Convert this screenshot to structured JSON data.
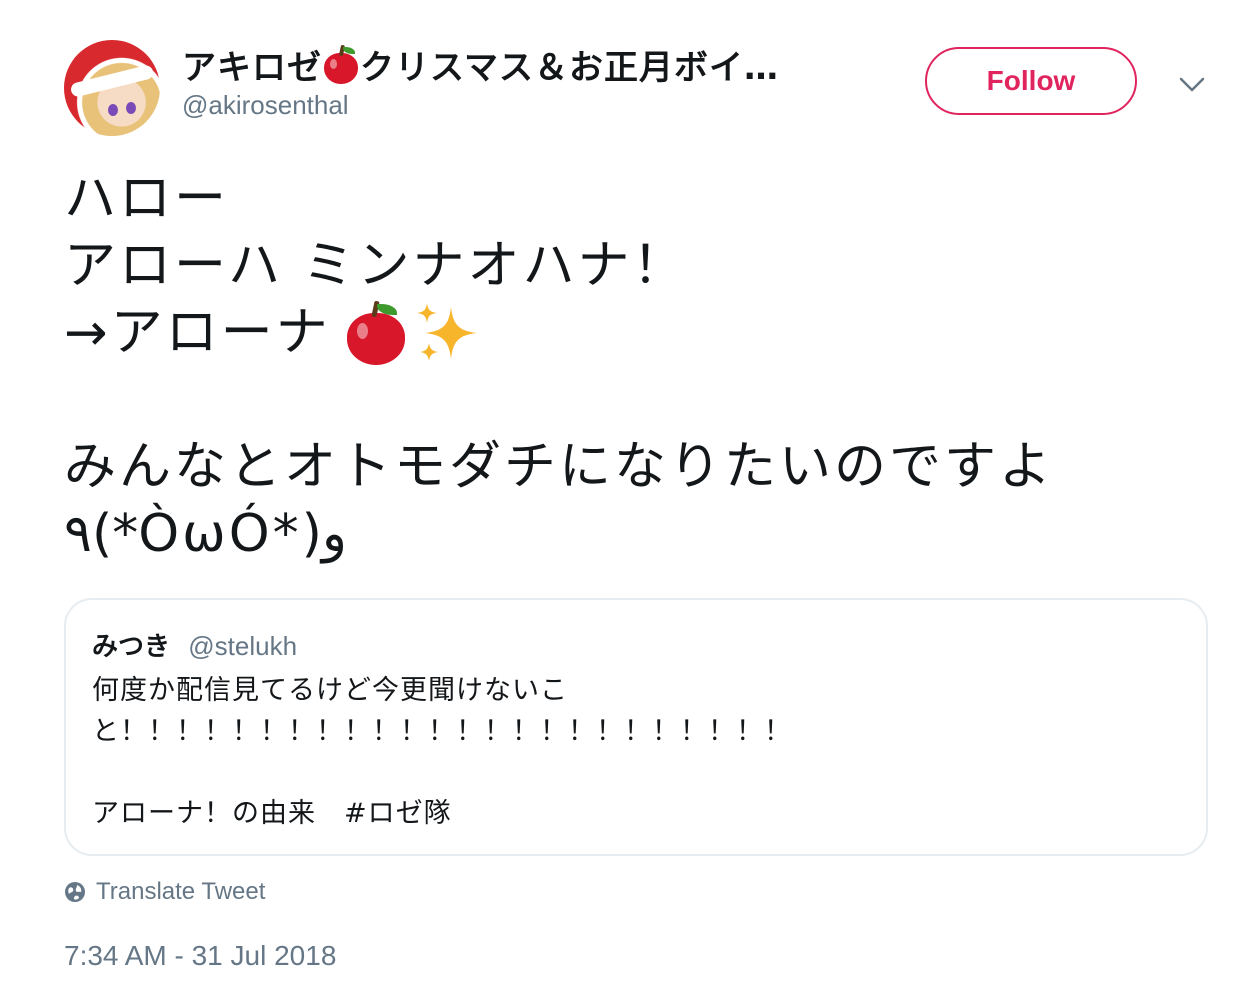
{
  "author": {
    "display_name_part1": "アキロゼ",
    "display_name_part2": "クリスマス＆お正月ボイ…",
    "display_name_emoji": "red-apple-emoji",
    "screen_name": "@akirosenthal",
    "avatar_label": "user-avatar"
  },
  "actions": {
    "follow_label": "Follow",
    "menu_icon": "chevron-down-icon"
  },
  "tweet": {
    "line1": "ハロー",
    "line2": "アローハ ミンナオハナ！",
    "line3": "→アローナ",
    "line3_emojis": [
      "red-apple-emoji",
      "sparkles-emoji"
    ],
    "line5": "みんなとオトモダチになりたいのですよ",
    "line6": "٩(*ÒωÓ*)و"
  },
  "quoted_tweet": {
    "name": "みつき",
    "handle": "@stelukh",
    "text_line1": "何度か配信見てるけど今更聞けないこ",
    "text_line2": "と！！！！！！！！！！！！！！！！！！！！！！！！",
    "text_line4": "アローナ！の由来　#ロゼ隊"
  },
  "footer": {
    "translate_label": "Translate Tweet",
    "timestamp": "7:34 AM - 31 Jul 2018"
  },
  "colors": {
    "follow_accent": "#e0245e",
    "secondary_text": "#657786",
    "primary_text": "#14171a",
    "card_border": "#e6ecf0"
  }
}
